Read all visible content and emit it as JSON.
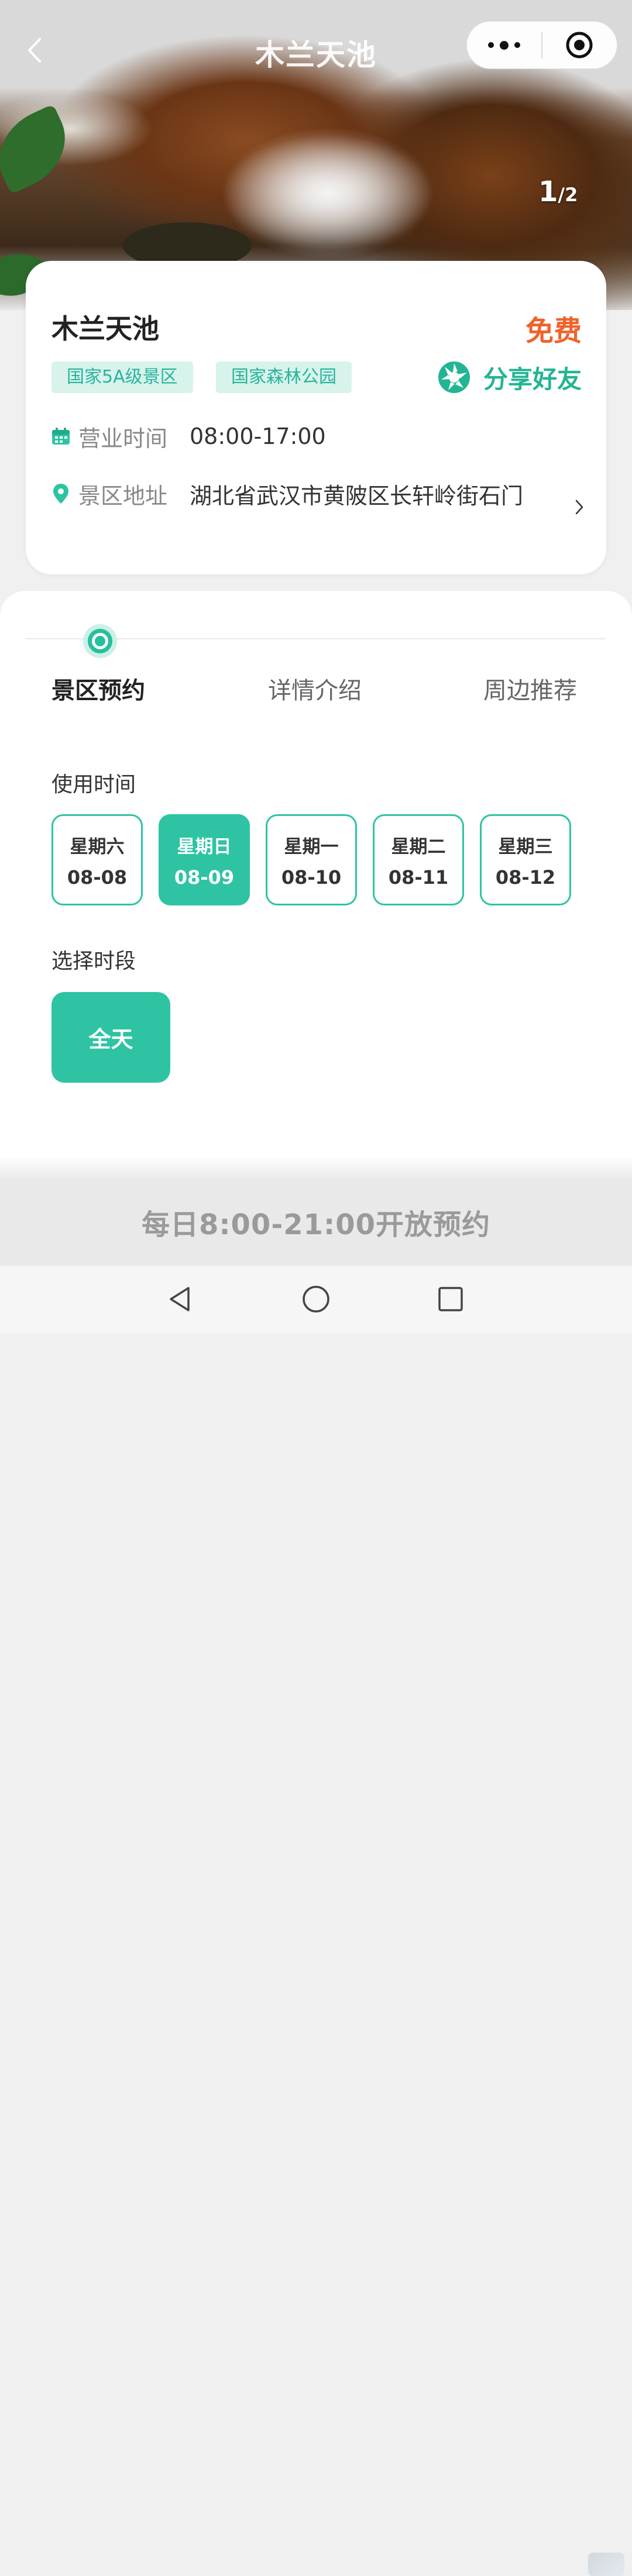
{
  "header": {
    "title": "木兰天池",
    "image_page_current": "1",
    "image_page_separator": "/",
    "image_page_total": "2"
  },
  "spot": {
    "name": "木兰天池",
    "price": "免费",
    "tags": [
      "国家5A级景区",
      "国家森林公园"
    ],
    "share_label": "分享好友",
    "hours_label": "营业时间",
    "hours_value": "08:00-17:00",
    "address_label": "景区地址",
    "address_value": "湖北省武汉市黄陂区长轩岭街石门"
  },
  "tabs": [
    {
      "label": "景区预约",
      "active": true
    },
    {
      "label": "详情介绍",
      "active": false
    },
    {
      "label": "周边推荐",
      "active": false
    }
  ],
  "booking": {
    "date_section_label": "使用时间",
    "dates": [
      {
        "weekday": "星期六",
        "date": "08-08",
        "selected": false
      },
      {
        "weekday": "星期日",
        "date": "08-09",
        "selected": true
      },
      {
        "weekday": "星期一",
        "date": "08-10",
        "selected": false
      },
      {
        "weekday": "星期二",
        "date": "08-11",
        "selected": false
      },
      {
        "weekday": "星期三",
        "date": "08-12",
        "selected": false
      }
    ],
    "slot_section_label": "选择时段",
    "slot_label": "全天"
  },
  "footer": {
    "notice": "每日8:00-21:00开放预约"
  },
  "colors": {
    "accent": "#2ec4a3",
    "price": "#f0622a",
    "tag_bg": "#d8f3ec",
    "tag_text": "#28b59b"
  },
  "icons": {
    "back": "chevron-left-icon",
    "more": "more-dots-icon",
    "close": "target-icon",
    "share": "aperture-icon",
    "calendar": "calendar-icon",
    "location": "location-pin-icon",
    "arrow": "chevron-right-icon"
  }
}
